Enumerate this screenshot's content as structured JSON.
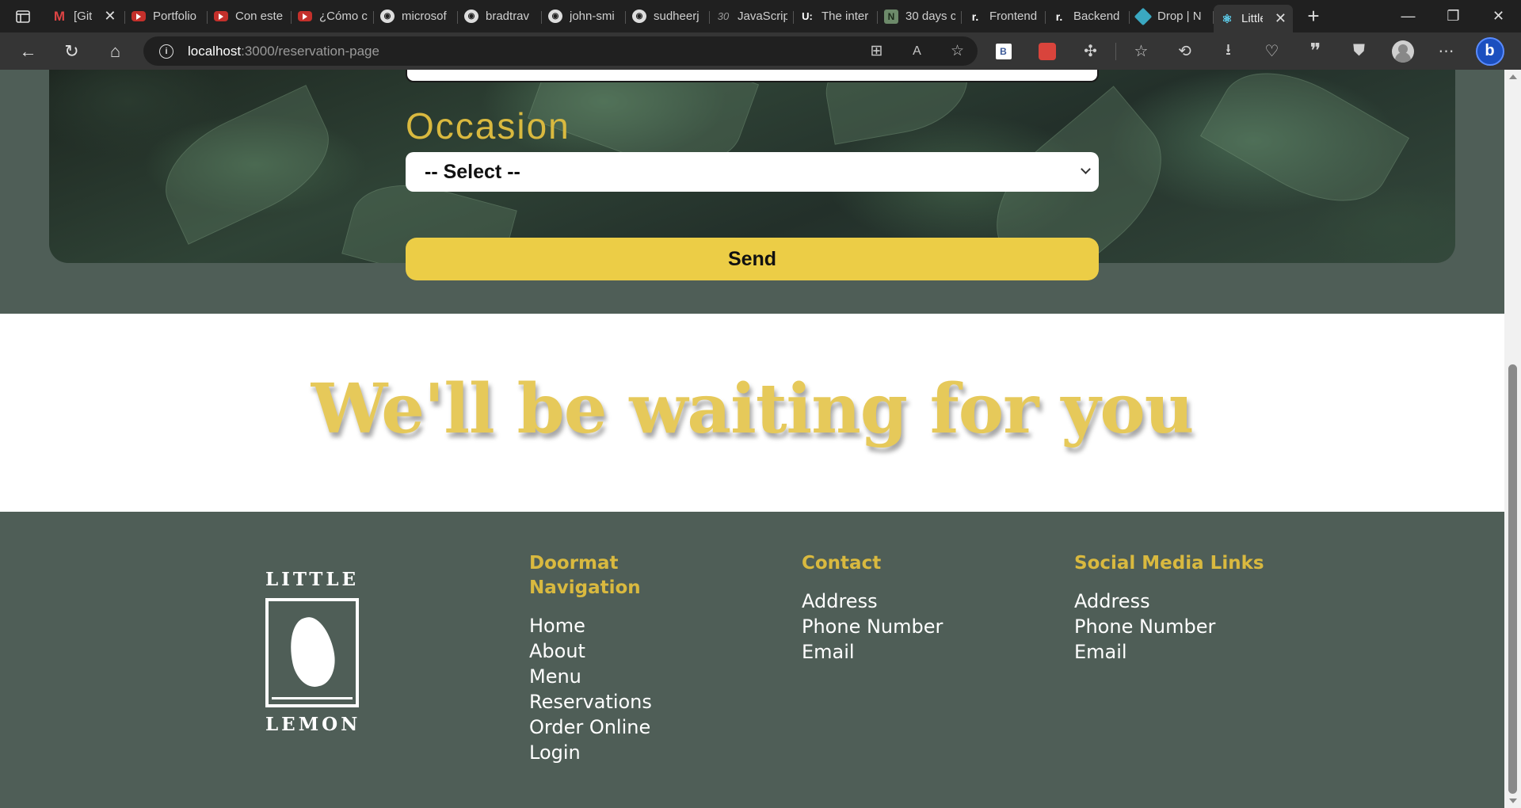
{
  "browser": {
    "tabs": [
      {
        "label": "[Git",
        "favicon": "gmail-icon"
      },
      {
        "label": "Portfolio",
        "favicon": "youtube-icon"
      },
      {
        "label": "Con este",
        "favicon": "youtube-icon"
      },
      {
        "label": "¿Cómo c",
        "favicon": "youtube-icon"
      },
      {
        "label": "microsof",
        "favicon": "github-icon"
      },
      {
        "label": "bradtrav",
        "favicon": "github-icon"
      },
      {
        "label": "john-smi",
        "favicon": "github-icon"
      },
      {
        "label": "sudheerj",
        "favicon": "github-icon"
      },
      {
        "label": "JavaScrip",
        "favicon": "thirty-icon"
      },
      {
        "label": "The inter",
        "favicon": "udemy-icon"
      },
      {
        "label": "30 days c",
        "favicon": "notion-icon"
      },
      {
        "label": "Frontend",
        "favicon": "roadmap-icon"
      },
      {
        "label": "Backend",
        "favicon": "roadmap-icon"
      },
      {
        "label": "Drop | N",
        "favicon": "drop-icon"
      },
      {
        "label": "Little",
        "favicon": "react-icon"
      }
    ],
    "url_host": "localhost",
    "url_path": ":3000/reservation-page"
  },
  "reservation": {
    "occasion_label": "Occasion",
    "occasion_selected": "-- Select --",
    "send_label": "Send"
  },
  "waiting": {
    "heading": "We'll be waiting for you"
  },
  "footer": {
    "logo_top": "LITTLE",
    "logo_bottom": "LEMON",
    "doormat": {
      "title": "Doormat Navigation",
      "links": [
        "Home",
        "About",
        "Menu",
        "Reservations",
        "Order Online",
        "Login"
      ]
    },
    "contact": {
      "title": "Contact",
      "links": [
        "Address",
        "Phone Number",
        "Email"
      ]
    },
    "social": {
      "title": "Social Media Links",
      "links": [
        "Address",
        "Phone Number",
        "Email"
      ]
    }
  },
  "colors": {
    "accent_yellow": "#eccd46",
    "heading_gold": "#d9b93f",
    "footer_green": "#4f5e57"
  }
}
